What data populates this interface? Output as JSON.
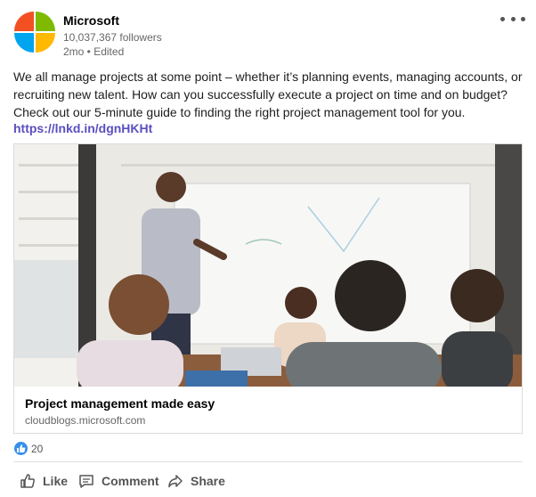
{
  "header": {
    "company": "Microsoft",
    "followers": "10,037,367 followers",
    "meta": "2mo • Edited",
    "more_icon": "ellipsis-icon"
  },
  "post": {
    "text": "We all manage projects at some point – whether it’s planning events, managing accounts, or recruiting new talent. How can you successfully execute a project on time and on budget? Check out our 5-minute guide to finding the right project management tool for you.",
    "link": "https://lnkd.in/dgnHKHt"
  },
  "preview": {
    "title": "Project management made easy",
    "source": "cloudblogs.microsoft.com"
  },
  "reactions": {
    "icon": "like-reaction-icon",
    "count": "20"
  },
  "actions": {
    "like": "Like",
    "comment": "Comment",
    "share": "Share"
  },
  "colors": {
    "link": "#5a4ec0",
    "reaction": "#378fe9",
    "logo_red": "#f25022",
    "logo_green": "#7fba00",
    "logo_blue": "#00a4ef",
    "logo_yellow": "#ffb900"
  }
}
